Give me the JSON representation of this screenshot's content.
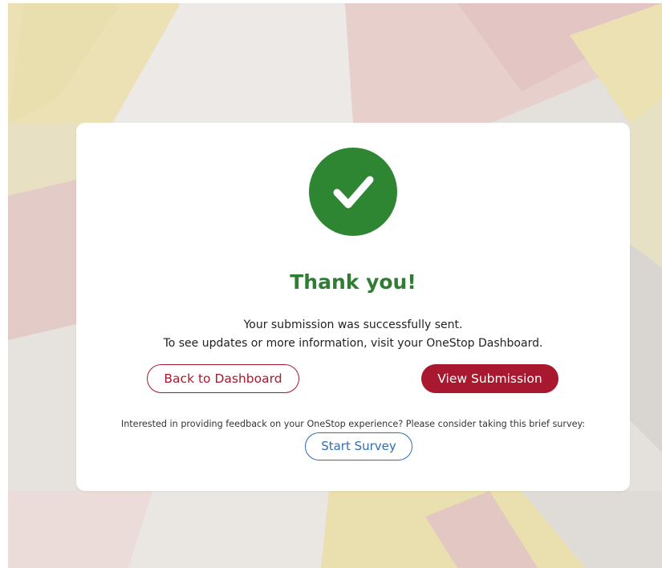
{
  "colors": {
    "success_green": "#2e8633",
    "title_green": "#2e7d32",
    "primary_red": "#a8182f",
    "survey_blue": "#2f6db3",
    "flag_gold": "#e8dcaa",
    "flag_red": "#e2c9c6",
    "flag_gray": "#dedbd7"
  },
  "icons": {
    "success": "check-icon"
  },
  "confirmation": {
    "title": "Thank you!",
    "message_line1": "Your submission was successfully sent.",
    "message_line2": "To see updates or more information, visit your OneStop Dashboard."
  },
  "actions": {
    "back_label": "Back to Dashboard",
    "view_label": "View Submission"
  },
  "survey": {
    "prompt": "Interested in providing feedback on your OneStop experience? Please consider taking this brief survey:",
    "button_label": "Start Survey"
  }
}
